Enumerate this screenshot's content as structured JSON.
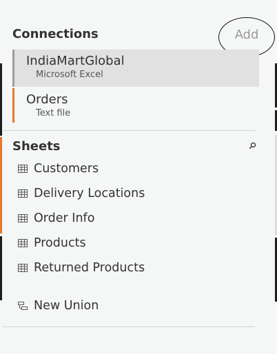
{
  "connections": {
    "header": "Connections",
    "add_label": "Add",
    "items": [
      {
        "name": "IndiaMartGlobal",
        "type": "Microsoft Excel",
        "selected": true
      },
      {
        "name": "Orders",
        "type": "Text file",
        "selected": false
      }
    ]
  },
  "sheets": {
    "header": "Sheets",
    "items": [
      {
        "label": "Customers",
        "icon": "table-icon"
      },
      {
        "label": "Delivery Locations",
        "icon": "table-icon"
      },
      {
        "label": "Order Info",
        "icon": "table-icon"
      },
      {
        "label": "Products",
        "icon": "table-icon"
      },
      {
        "label": "Returned Products",
        "icon": "table-icon"
      }
    ],
    "new_union_label": "New Union",
    "new_union_icon": "union-icon"
  },
  "colors": {
    "accent_orange": "#e8762d",
    "selected_bg": "#e1e1e1",
    "panel_bg": "#f5f6f6"
  }
}
